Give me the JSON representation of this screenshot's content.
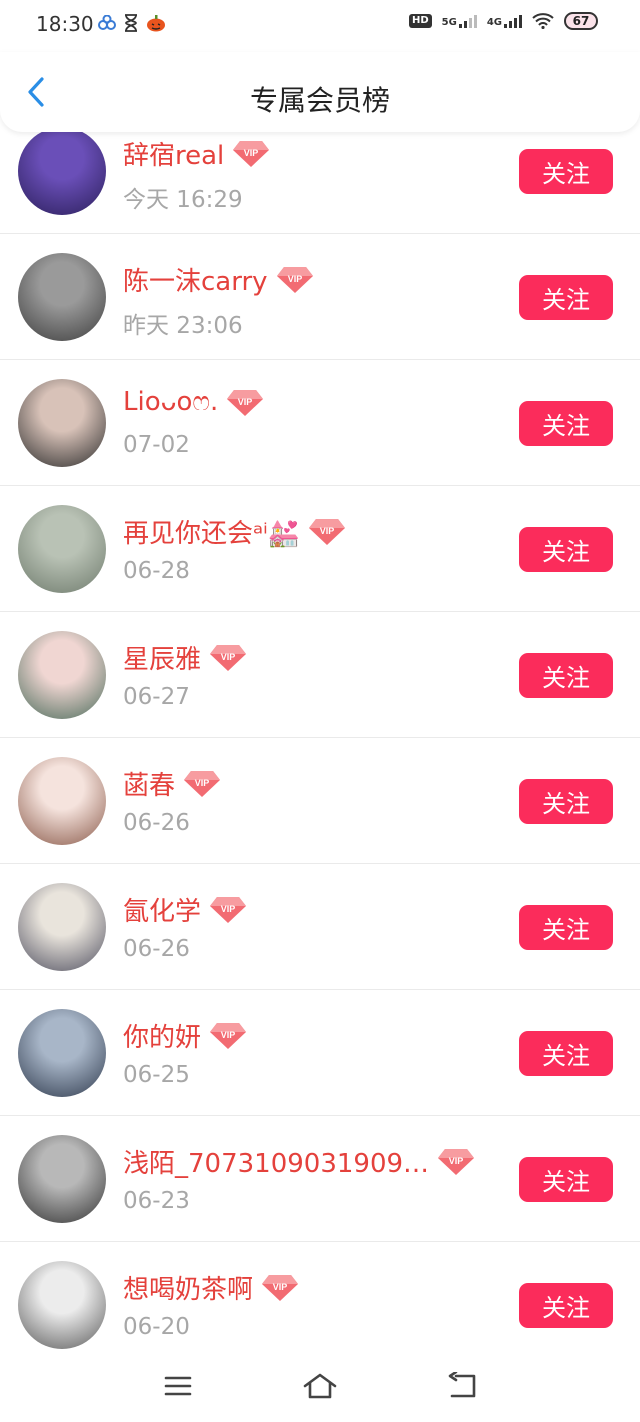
{
  "status_bar": {
    "time": "18:30",
    "hd": "HD",
    "net_5g": "5G",
    "net_4g": "4G",
    "battery": "67"
  },
  "header": {
    "title": "专属会员榜",
    "back_icon": "chevron-left-icon"
  },
  "accent_colors": {
    "name": "#e4413c",
    "button": "#fb2c5b",
    "back": "#2a8ee6"
  },
  "follow_label": "关注",
  "members": [
    {
      "name": "辞宿real",
      "date": "今天 16:29",
      "vip": "VIP"
    },
    {
      "name": "陈一沫carry",
      "date": "昨天 23:06",
      "vip": "VIP"
    },
    {
      "name": "Lioᴗoෆ.",
      "date": "07-02",
      "vip": "VIP"
    },
    {
      "name": "再见你还会ᵃⁱ💒",
      "date": "06-28",
      "vip": "VIP"
    },
    {
      "name": "星辰雅",
      "date": "06-27",
      "vip": "VIP"
    },
    {
      "name": "菡春",
      "date": "06-26",
      "vip": "VIP"
    },
    {
      "name": "氤化学",
      "date": "06-26",
      "vip": "VIP"
    },
    {
      "name": "你的妍",
      "date": "06-25",
      "vip": "VIP"
    },
    {
      "name": "浅陌_7073109031909…",
      "date": "06-23",
      "vip": "VIP"
    },
    {
      "name": "想喝奶茶啊",
      "date": "06-20",
      "vip": "VIP"
    }
  ],
  "nav_bar": {
    "menu_icon": "menu-icon",
    "home_icon": "home-icon",
    "back_icon": "back-icon"
  }
}
